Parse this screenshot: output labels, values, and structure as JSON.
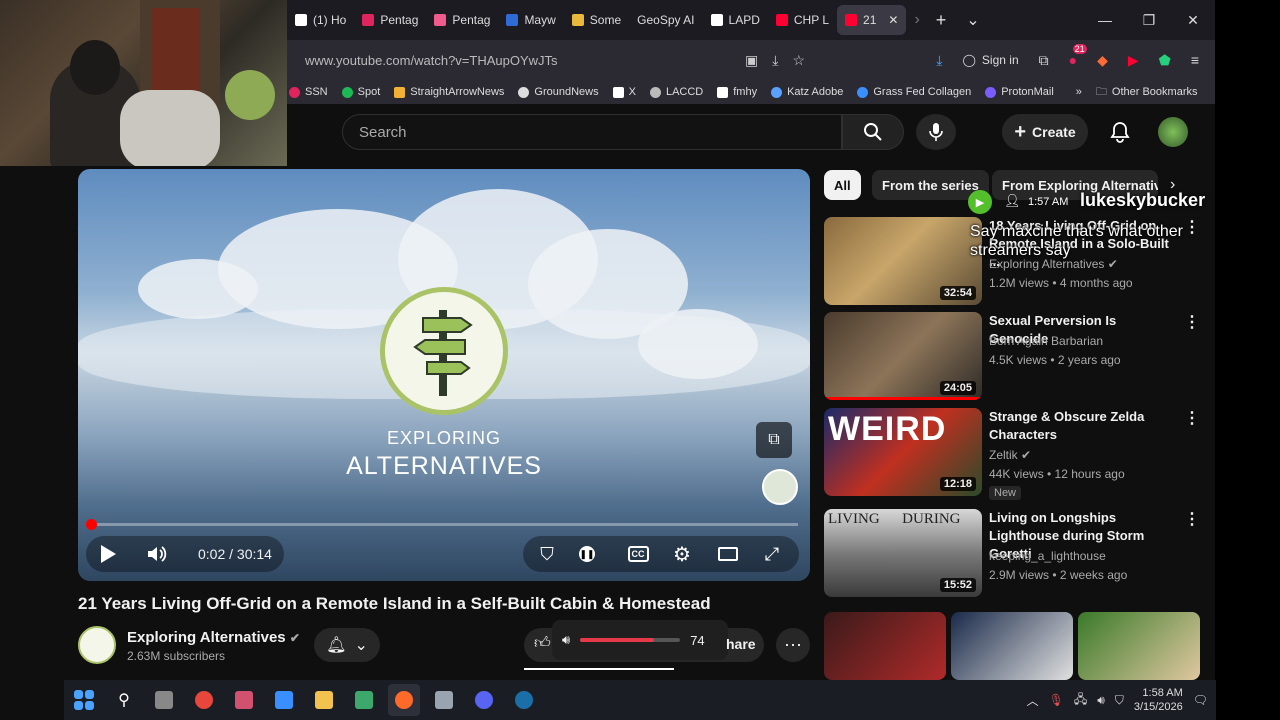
{
  "browser": {
    "tabs": [
      {
        "label": "(1) Ho",
        "color": "#ffffff"
      },
      {
        "label": "Pentag",
        "color": "#e0245e"
      },
      {
        "label": "Pentag",
        "color": "#f05a8c"
      },
      {
        "label": "Mayw",
        "color": "#2f6bd6"
      },
      {
        "label": "Some",
        "color": "#e8b93a"
      },
      {
        "label": "GeoSpy AI",
        "color": "#555555"
      },
      {
        "label": "LAPD",
        "color": "#ffffff"
      },
      {
        "label": "CHP L",
        "color": "#ff0033"
      },
      {
        "label": "21",
        "color": "#ff0033"
      }
    ],
    "url": "www.youtube.com/watch?v=THAupOYwJTs",
    "sign_in": "Sign in",
    "ext_badge": "21",
    "bookmarks": [
      {
        "label": "SSN",
        "color": "#e0245e"
      },
      {
        "label": "Spot",
        "color": "#1db954"
      },
      {
        "label": "StraightArrowNews",
        "color": "#f2b233"
      },
      {
        "label": "GroundNews",
        "color": "#dddddd"
      },
      {
        "label": "X",
        "color": "#ffffff"
      },
      {
        "label": "LACCD",
        "color": "#bbbbbb"
      },
      {
        "label": "fmhy",
        "color": "#ffffff"
      },
      {
        "label": "Katz Adobe",
        "color": "#5aa0ff"
      },
      {
        "label": "Grass Fed Collagen",
        "color": "#3a8fff"
      },
      {
        "label": "ProtonMail",
        "color": "#7b5cff"
      }
    ],
    "other_bookmarks": "Other Bookmarks"
  },
  "yt": {
    "search_placeholder": "Search",
    "create_label": "Create"
  },
  "player": {
    "brand_line1": "EXPLORING",
    "brand_line2": "ALTERNATIVES",
    "time": "0:02 / 30:14",
    "progress_fraction": 0.001
  },
  "video": {
    "title": "21 Years Living Off-Grid on a Remote Island in a Self-Built Cabin & Homestead",
    "channel": "Exploring Alternatives",
    "subscribers": "2.63M subscribers",
    "volume": "74",
    "share_label": "hare"
  },
  "sidebar": {
    "chips": [
      "All",
      "From the series",
      "From Exploring Alternativ"
    ],
    "recs": [
      {
        "title": "18 Years Living Off-Grid on Remote Island in a Solo-Built ...",
        "channel": "Exploring Alternatives",
        "meta": "1.2M views • 4 months ago",
        "duration": "32:54",
        "new": ""
      },
      {
        "title": "Sexual Perversion Is Genocide",
        "channel": "Born Again Barbarian",
        "meta": "4.5K views • 2 years ago",
        "duration": "24:05",
        "new": ""
      },
      {
        "title": "Strange & Obscure Zelda Characters",
        "channel": "Zeltik",
        "meta": "44K views • 12 hours ago",
        "duration": "12:18",
        "new": "New"
      },
      {
        "title": "Living on Longships Lighthouse during Storm Goretti",
        "channel": "keeping_a_lighthouse",
        "meta": "2.9M views • 2 weeks ago",
        "duration": "15:52",
        "new": ""
      }
    ]
  },
  "overlay": {
    "time": "1:57 AM",
    "user": "lukeskybucker",
    "message": "Say maxcine that's what other streamers say"
  },
  "taskbar": {
    "time": "1:58 AM",
    "date": "3/15/2026"
  }
}
